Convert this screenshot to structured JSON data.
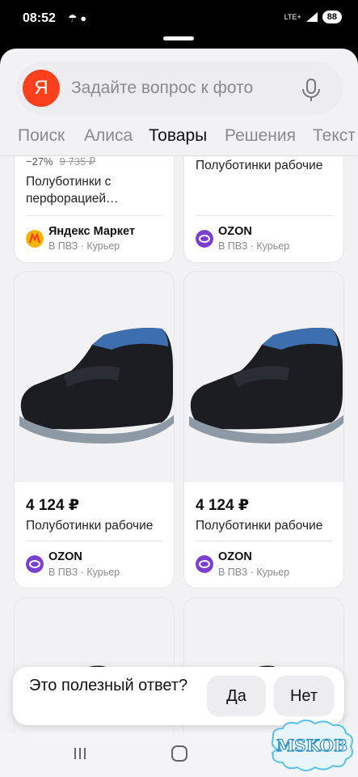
{
  "status_bar": {
    "time": "08:52",
    "left_icons": "☂ ●",
    "network": "LTE+",
    "battery": "88"
  },
  "search": {
    "placeholder": "Задайте вопрос к фото",
    "logo": "Я"
  },
  "tabs": [
    {
      "label": "Поиск"
    },
    {
      "label": "Алиса"
    },
    {
      "label": "Товары"
    },
    {
      "label": "Решения"
    },
    {
      "label": "Текст"
    }
  ],
  "active_tab": "Товары",
  "products": [
    {
      "discount": "−27%",
      "old_price": "9 735 ₽",
      "title": "Полуботинки с перфорацией…",
      "shop": "Яндекс Маркет",
      "delivery": "В ПВЗ · Курьер",
      "shop_color": "#f5b400"
    },
    {
      "title": "Полуботинки рабочие",
      "shop": "OZON",
      "delivery": "В ПВЗ · Курьер",
      "shop_color": "#7b3fd0"
    },
    {
      "price": "4 124 ₽",
      "title": "Полуботинки рабочие",
      "shop": "OZON",
      "delivery": "В ПВЗ · Курьер",
      "shop_color": "#7b3fd0"
    },
    {
      "price": "4 124 ₽",
      "title": "Полуботинки рабочие",
      "shop": "OZON",
      "delivery": "В ПВЗ · Курьер",
      "shop_color": "#7b3fd0"
    }
  ],
  "feedback": {
    "question": "Это полезный ответ?",
    "yes": "Да",
    "no": "Нет"
  },
  "watermark": {
    "text": "MSKOB"
  },
  "colors": {
    "accent": "#fc3f1d",
    "ozon": "#7b3fd0",
    "market": "#f5b400"
  }
}
